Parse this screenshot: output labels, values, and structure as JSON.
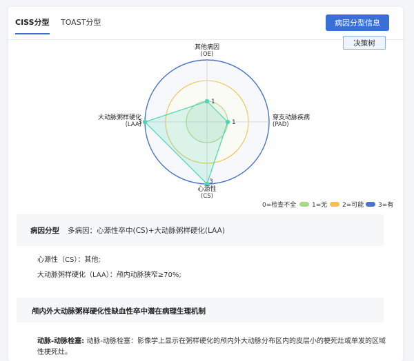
{
  "tabs": [
    {
      "label": "CISS分型",
      "active": true
    },
    {
      "label": "TOAST分型",
      "active": false
    }
  ],
  "buttons": {
    "etiology_info": "病因分型信息",
    "decision_tree": "决策树"
  },
  "radar": {
    "axes": [
      {
        "name": "其他病因",
        "abbr": "(OE)",
        "value": 1
      },
      {
        "name": "穿支动脉疾病",
        "abbr": "(PAD)",
        "value": 1
      },
      {
        "name": "心源性",
        "abbr": "(CS)",
        "value": 3
      },
      {
        "name": "大动脉粥样硬化",
        "abbr": "(LAA)",
        "value": 3
      }
    ],
    "max": 3,
    "levels": [
      1,
      2,
      3
    ],
    "colors": {
      "level1": "#a8d98a",
      "level2": "#f2c14e",
      "level3": "#4a73c9",
      "series": "#4dd4b0"
    }
  },
  "legend": {
    "items": [
      {
        "label": "0=检查不全",
        "color": ""
      },
      {
        "label": "1=无",
        "color": "#a8d98a"
      },
      {
        "label": "2=可能",
        "color": "#f2c14e"
      },
      {
        "label": "3=有",
        "color": "#4a73c9"
      }
    ]
  },
  "classification": {
    "title": "病因分型",
    "value": "多病因：心源性卒中(CS)+大动脉粥样硬化(LAA)"
  },
  "details": [
    "心源性（CS）：其他;",
    "大动脉粥样硬化（LAA）：颅内动脉狭窄≥70%;"
  ],
  "mechanism": {
    "title": "颅内外大动脉粥样硬化性缺血性卒中潜在病理生理机制",
    "item_label": "动脉-动脉栓塞:",
    "item_text_line1": "动脉-动脉栓塞：影像学上显示在粥样硬化的颅内外大动脉分布区内的皮层小的梗死灶或单发的区域",
    "item_text_line2": "性梗死灶。"
  }
}
